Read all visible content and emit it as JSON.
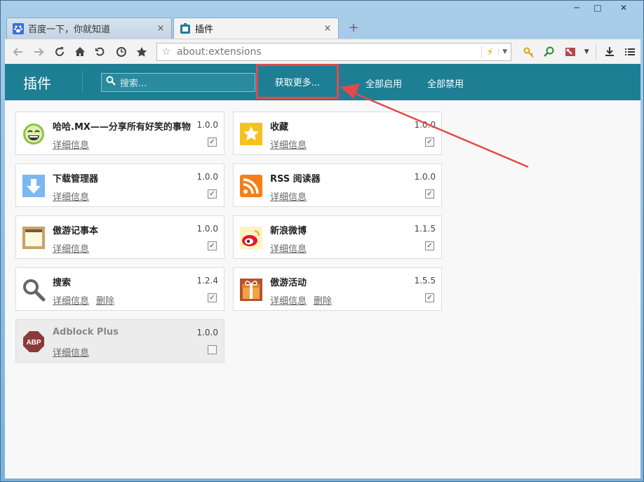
{
  "window": {
    "minimize": "─",
    "maximize": "□",
    "close": "✕"
  },
  "tabs": [
    {
      "label": "百度一下，你就知道",
      "icon": "baidu-paw-icon",
      "close": "×",
      "active": false
    },
    {
      "label": "插件",
      "icon": "extensions-icon",
      "close": "×",
      "active": true
    }
  ],
  "new_tab": "+",
  "toolbar": {
    "address": "about:extensions",
    "icons": [
      "back-icon",
      "forward-icon",
      "reload-icon",
      "home-icon",
      "undo-close-icon",
      "history-icon",
      "bookmark-star-icon",
      "bolt-icon",
      "key-icon",
      "magnifier-refresh-icon",
      "toolbox-icon",
      "download-icon",
      "menu-icon"
    ]
  },
  "header": {
    "title": "插件",
    "search_placeholder": "搜索...",
    "get_more": "获取更多...",
    "enable_all": "全部启用",
    "disable_all": "全部禁用",
    "accent": "#1e7e94"
  },
  "extensions": [
    {
      "name": "哈哈.MX——分享所有好笑的事物",
      "version": "1.0.0",
      "detail": "详细信息",
      "enabled": true
    },
    {
      "name": "收藏",
      "version": "1.0.0",
      "detail": "详细信息",
      "enabled": true
    },
    {
      "name": "下载管理器",
      "version": "1.0.0",
      "detail": "详细信息",
      "enabled": true
    },
    {
      "name": "RSS 阅读器",
      "version": "1.0.0",
      "detail": "详细信息",
      "enabled": true
    },
    {
      "name": "傲游记事本",
      "version": "1.0.0",
      "detail": "详细信息",
      "enabled": true
    },
    {
      "name": "新浪微博",
      "version": "1.1.5",
      "detail": "详细信息",
      "enabled": true
    },
    {
      "name": "搜索",
      "version": "1.2.4",
      "detail": "详细信息",
      "delete": "删除",
      "enabled": true
    },
    {
      "name": "傲游活动",
      "version": "1.5.5",
      "detail": "详细信息",
      "delete": "删除",
      "enabled": true
    },
    {
      "name": "Adblock Plus",
      "version": "1.0.0",
      "detail": "详细信息",
      "enabled": false,
      "abp": "ABP"
    }
  ]
}
